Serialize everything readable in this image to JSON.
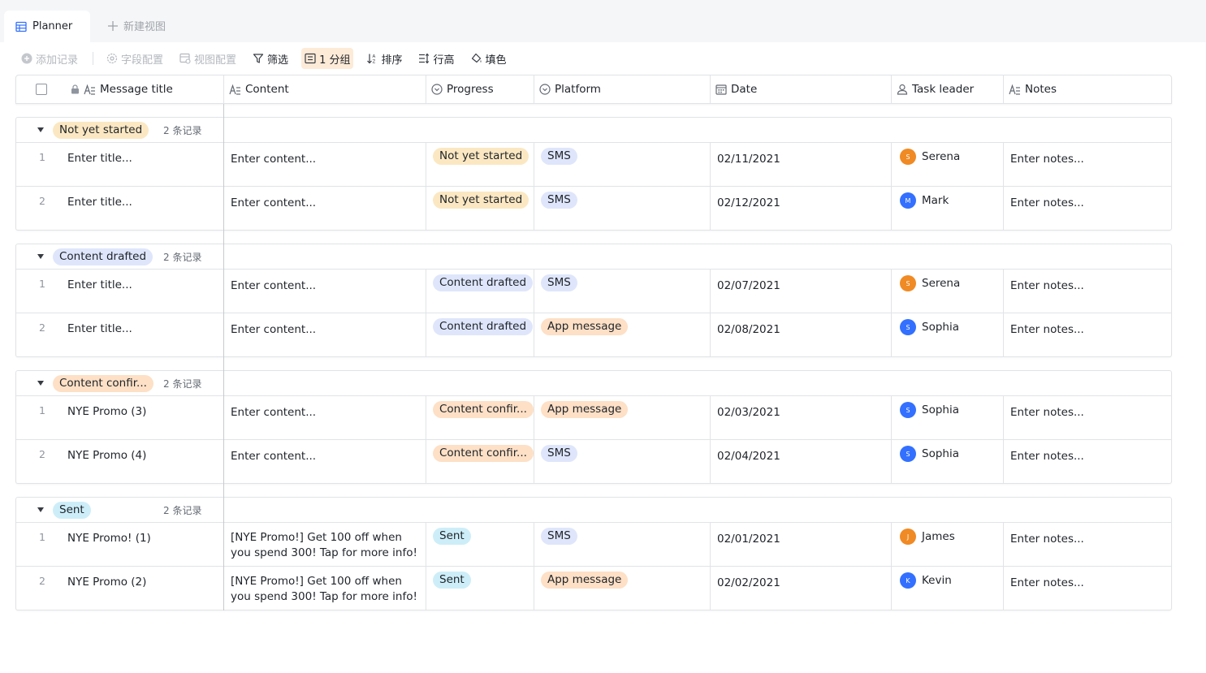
{
  "tabs": {
    "active_label": "Planner",
    "new_view_label": "新建视图"
  },
  "toolbar": {
    "add_record": "添加记录",
    "field_config": "字段配置",
    "view_config": "视图配置",
    "filter": "筛选",
    "group": "1 分组",
    "sort": "排序",
    "row_height": "行高",
    "fill_color": "填色"
  },
  "columns": {
    "title": "Message title",
    "content": "Content",
    "progress": "Progress",
    "platform": "Platform",
    "date": "Date",
    "task_leader": "Task leader",
    "notes": "Notes"
  },
  "groups": [
    {
      "label": "Not yet started",
      "count": "2 条记录",
      "rows": [
        {
          "num": "1",
          "title": "Enter title...",
          "content": "Enter content...",
          "progress": "Not yet started",
          "platform": "SMS",
          "date": "02/11/2021",
          "leader": "Serena",
          "initial": "S",
          "notes": "Enter notes..."
        },
        {
          "num": "2",
          "title": "Enter title...",
          "content": "Enter content...",
          "progress": "Not yet started",
          "platform": "SMS",
          "date": "02/12/2021",
          "leader": "Mark",
          "initial": "M",
          "notes": "Enter notes..."
        }
      ]
    },
    {
      "label": "Content drafted",
      "count": "2 条记录",
      "rows": [
        {
          "num": "1",
          "title": "Enter title...",
          "content": "Enter content...",
          "progress": "Content drafted",
          "platform": "SMS",
          "date": "02/07/2021",
          "leader": "Serena",
          "initial": "S",
          "notes": "Enter notes..."
        },
        {
          "num": "2",
          "title": "Enter title...",
          "content": "Enter content...",
          "progress": "Content drafted",
          "platform": "App message",
          "date": "02/08/2021",
          "leader": "Sophia",
          "initial": "S",
          "notes": "Enter notes..."
        }
      ]
    },
    {
      "label": "Content confir...",
      "count": "2 条记录",
      "rows": [
        {
          "num": "1",
          "title": "NYE Promo (3)",
          "content": "Enter content...",
          "progress": "Content confir...",
          "platform": "App message",
          "date": "02/03/2021",
          "leader": "Sophia",
          "initial": "S",
          "notes": "Enter notes..."
        },
        {
          "num": "2",
          "title": "NYE Promo (4)",
          "content": "Enter content...",
          "progress": "Content confir...",
          "platform": "SMS",
          "date": "02/04/2021",
          "leader": "Sophia",
          "initial": "S",
          "notes": "Enter notes..."
        }
      ]
    },
    {
      "label": "Sent",
      "count": "2 条记录",
      "rows": [
        {
          "num": "1",
          "title": "NYE Promo! (1)",
          "content": "[NYE Promo!] Get 100 off when you spend 300! Tap for more info!",
          "progress": "Sent",
          "platform": "SMS",
          "date": "02/01/2021",
          "leader": "James",
          "initial": "J",
          "notes": "Enter notes..."
        },
        {
          "num": "2",
          "title": "NYE Promo (2)",
          "content": "[NYE Promo!] Get 100 off when you spend 300! Tap for more info!",
          "progress": "Sent",
          "platform": "App message",
          "date": "02/02/2021",
          "leader": "Kevin",
          "initial": "K",
          "notes": "Enter notes..."
        }
      ]
    }
  ],
  "colors": {
    "avatar_orange": "#f08a24",
    "avatar_blue": "#3370ff",
    "accent_active": "#fdebd8"
  }
}
